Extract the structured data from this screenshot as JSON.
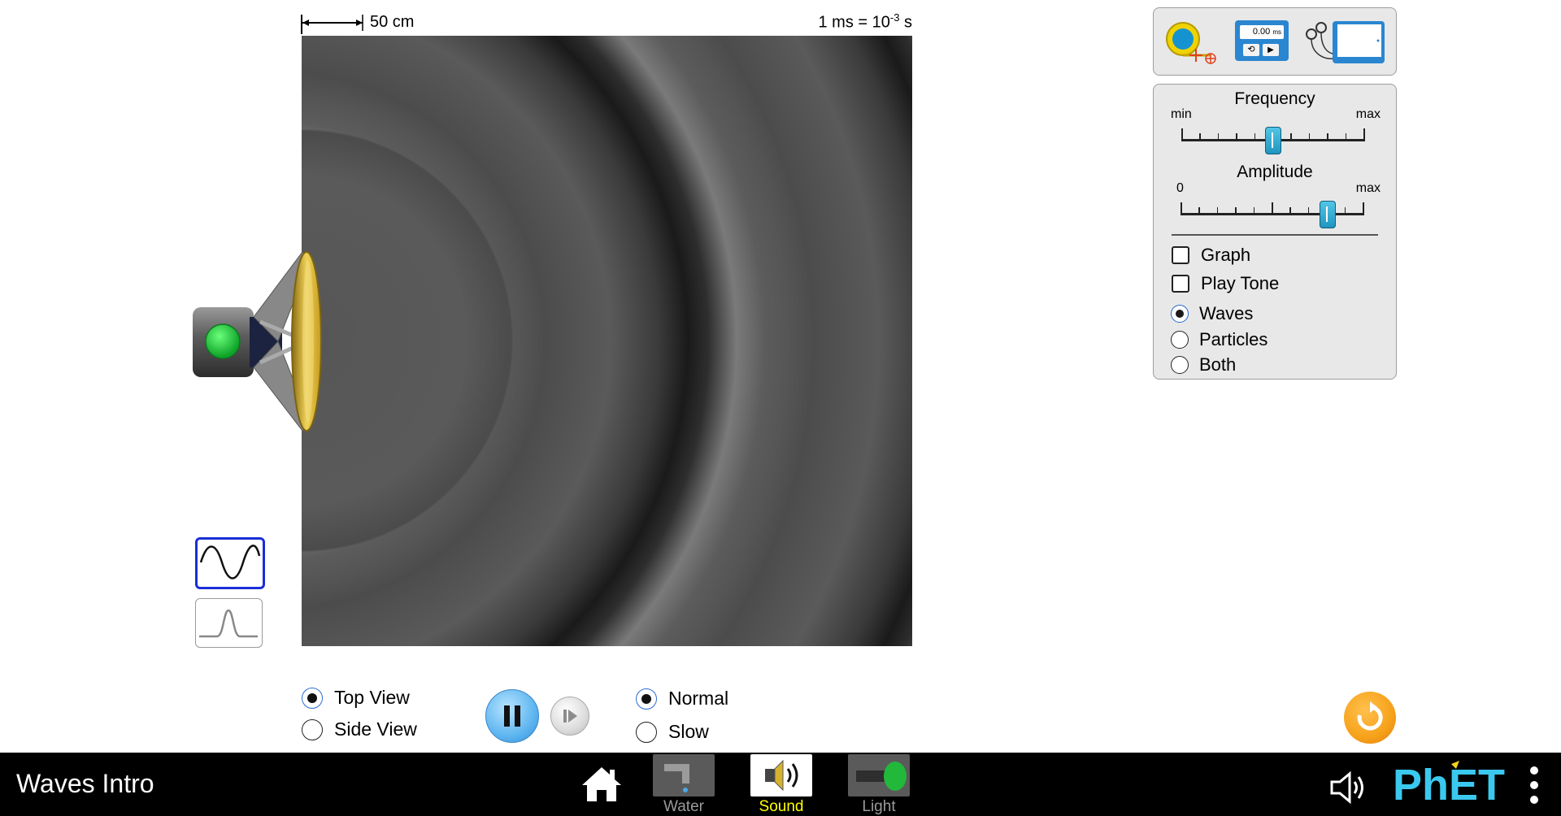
{
  "scale": {
    "label": "50 cm"
  },
  "time_scale": {
    "prefix": "1 ms = 10",
    "exponent": "-3",
    "suffix": " s"
  },
  "tools": {
    "stopwatch_readout": "0.00",
    "stopwatch_unit": "ms"
  },
  "frequency": {
    "title": "Frequency",
    "min_label": "min",
    "max_label": "max",
    "level": 0.5
  },
  "amplitude": {
    "title": "Amplitude",
    "min_label": "0",
    "max_label": "max",
    "level": 0.8
  },
  "checkboxes": [
    {
      "label": "Graph",
      "checked": false
    },
    {
      "label": "Play Tone",
      "checked": false
    }
  ],
  "view_modes": [
    {
      "label": "Waves",
      "selected": true
    },
    {
      "label": "Particles",
      "selected": false
    },
    {
      "label": "Both",
      "selected": false
    }
  ],
  "views": [
    {
      "label": "Top View",
      "selected": true
    },
    {
      "label": "Side View",
      "selected": false
    }
  ],
  "speeds": [
    {
      "label": "Normal",
      "selected": true
    },
    {
      "label": "Slow",
      "selected": false
    }
  ],
  "navbar": {
    "title": "Waves Intro",
    "screens": [
      {
        "label": "Water",
        "selected": false,
        "color": "#9a9a9a"
      },
      {
        "label": "Sound",
        "selected": true,
        "color": "#ffff00"
      },
      {
        "label": "Light",
        "selected": false,
        "color": "#9a9a9a"
      }
    ],
    "brand": "PhET"
  },
  "colors": {
    "accent_blue": "#2a9fd6",
    "reset_orange": "#f6a21b",
    "speaker_green": "#22c03a",
    "selected_screen_label": "#ffff00"
  }
}
